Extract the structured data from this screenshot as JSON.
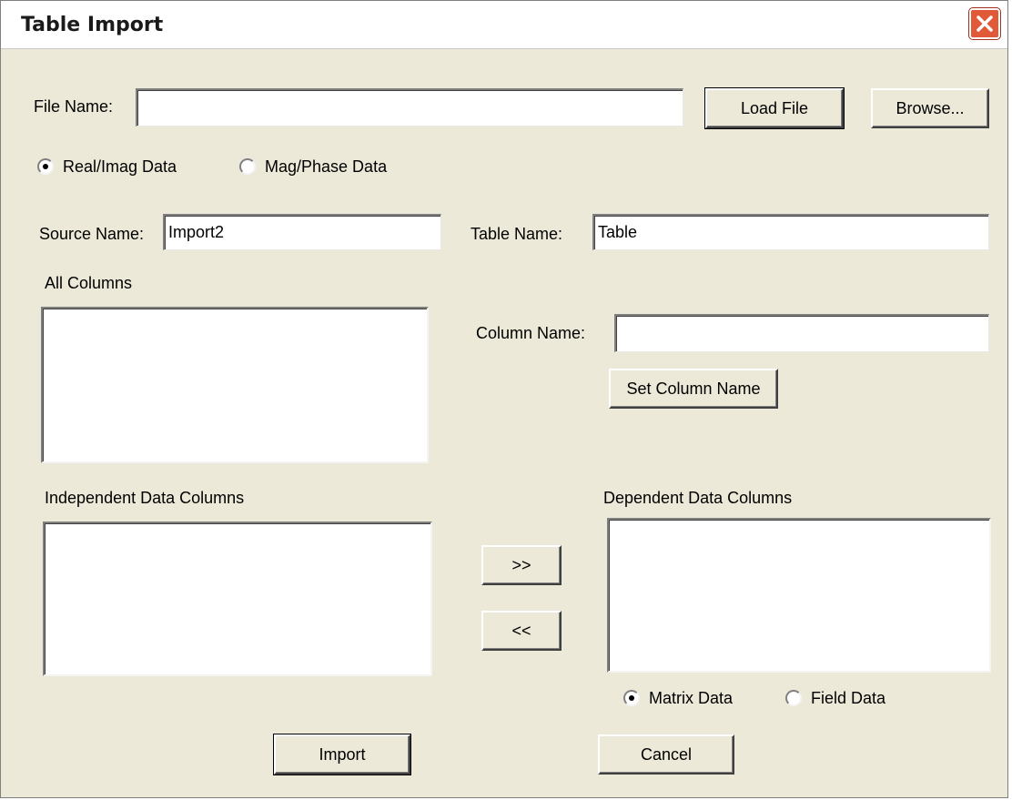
{
  "window": {
    "title": "Table Import"
  },
  "file": {
    "label": "File Name:",
    "value": "",
    "load_label": "Load File",
    "browse_label": "Browse..."
  },
  "data_format": {
    "options": [
      "Real/Imag Data",
      "Mag/Phase Data"
    ],
    "selected": "Real/Imag Data"
  },
  "source": {
    "label": "Source Name:",
    "value": "Import2"
  },
  "table": {
    "label": "Table Name:",
    "value": "Table"
  },
  "all_columns": {
    "label": "All Columns",
    "items": []
  },
  "column_name": {
    "label": "Column Name:",
    "value": "",
    "set_label": "Set Column Name"
  },
  "independent": {
    "label": "Independent Data Columns",
    "items": []
  },
  "dependent": {
    "label": "Dependent Data Columns",
    "items": []
  },
  "move": {
    "right_label": ">>",
    "left_label": "<<"
  },
  "dependent_type": {
    "options": [
      "Matrix Data",
      "Field Data"
    ],
    "selected": "Matrix Data"
  },
  "actions": {
    "import_label": "Import",
    "cancel_label": "Cancel"
  }
}
